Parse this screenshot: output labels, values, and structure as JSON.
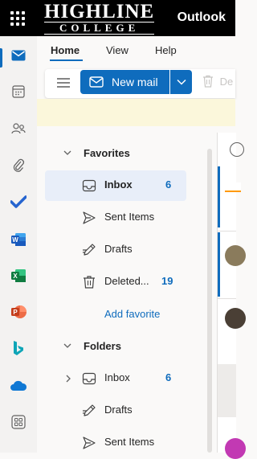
{
  "header": {
    "logo_line1": "HIGHLINE",
    "logo_line2": "COLLEGE",
    "app_name": "Outlook"
  },
  "ribbon": {
    "tabs": [
      "Home",
      "View",
      "Help"
    ],
    "selected_tab": "Home",
    "new_mail_label": "New mail",
    "delete_label": "De"
  },
  "rail": {
    "items": [
      "mail-icon",
      "calendar-icon",
      "people-icon",
      "attachment-icon",
      "todo-icon",
      "word-icon",
      "excel-icon",
      "powerpoint-icon",
      "bing-icon",
      "onedrive-icon",
      "more-apps-icon"
    ],
    "selected": "mail-icon"
  },
  "favorites": {
    "title": "Favorites",
    "items": [
      {
        "label": "Inbox",
        "count": "6",
        "icon": "inbox-icon"
      },
      {
        "label": "Sent Items",
        "count": "",
        "icon": "sent-icon"
      },
      {
        "label": "Drafts",
        "count": "",
        "icon": "drafts-icon"
      },
      {
        "label": "Deleted...",
        "count": "19",
        "icon": "trash-icon"
      }
    ],
    "add_favorite": "Add favorite"
  },
  "folders": {
    "title": "Folders",
    "items": [
      {
        "label": "Inbox",
        "count": "6",
        "icon": "inbox-icon"
      },
      {
        "label": "Drafts",
        "count": "",
        "icon": "drafts-icon"
      },
      {
        "label": "Sent Items",
        "count": "",
        "icon": "sent-icon"
      }
    ]
  },
  "colors": {
    "accent": "#0f6cbd",
    "header_bg": "#000000",
    "banner_bg": "#fbf7db"
  }
}
